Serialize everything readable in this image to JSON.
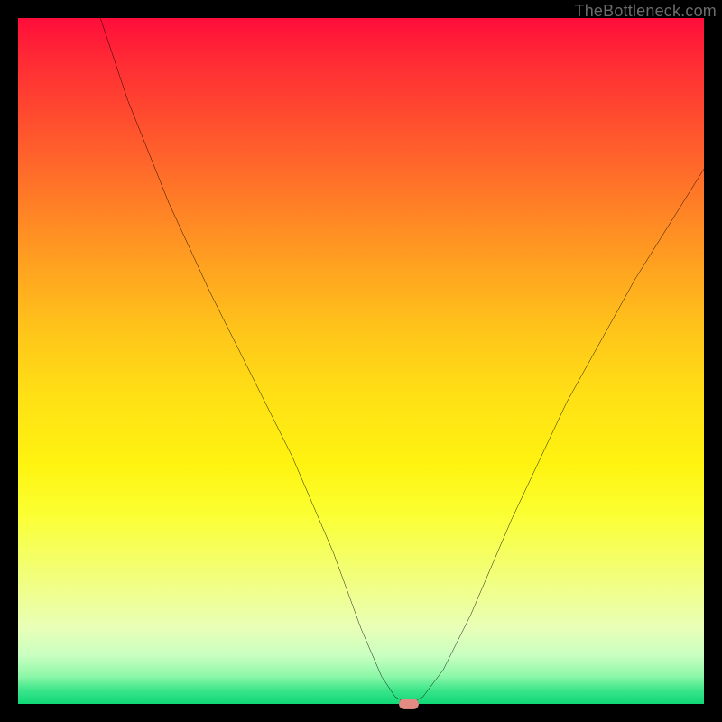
{
  "watermark": "TheBottleneck.com",
  "chart_data": {
    "type": "line",
    "title": "",
    "xlabel": "",
    "ylabel": "",
    "xlim": [
      0,
      100
    ],
    "ylim": [
      0,
      100
    ],
    "grid": false,
    "legend": false,
    "background_gradient": {
      "direction": "vertical",
      "stops": [
        {
          "pos": 0.0,
          "color": "#ff0d3a"
        },
        {
          "pos": 0.3,
          "color": "#ff8a24"
        },
        {
          "pos": 0.55,
          "color": "#ffe015"
        },
        {
          "pos": 0.78,
          "color": "#f5ff60"
        },
        {
          "pos": 0.93,
          "color": "#c8ffc0"
        },
        {
          "pos": 1.0,
          "color": "#10d878"
        }
      ]
    },
    "series": [
      {
        "name": "bottleneck-curve",
        "color": "#000000",
        "x": [
          12,
          16,
          22,
          28,
          34,
          40,
          46,
          50,
          53,
          55,
          57,
          59,
          62,
          66,
          72,
          80,
          90,
          100
        ],
        "y": [
          100,
          88,
          73,
          60,
          48,
          36,
          22,
          11,
          4,
          1,
          0,
          1,
          5,
          13,
          27,
          44,
          62,
          78
        ]
      }
    ],
    "marker": {
      "x": 57,
      "y": 0,
      "color": "#e38a82"
    }
  }
}
